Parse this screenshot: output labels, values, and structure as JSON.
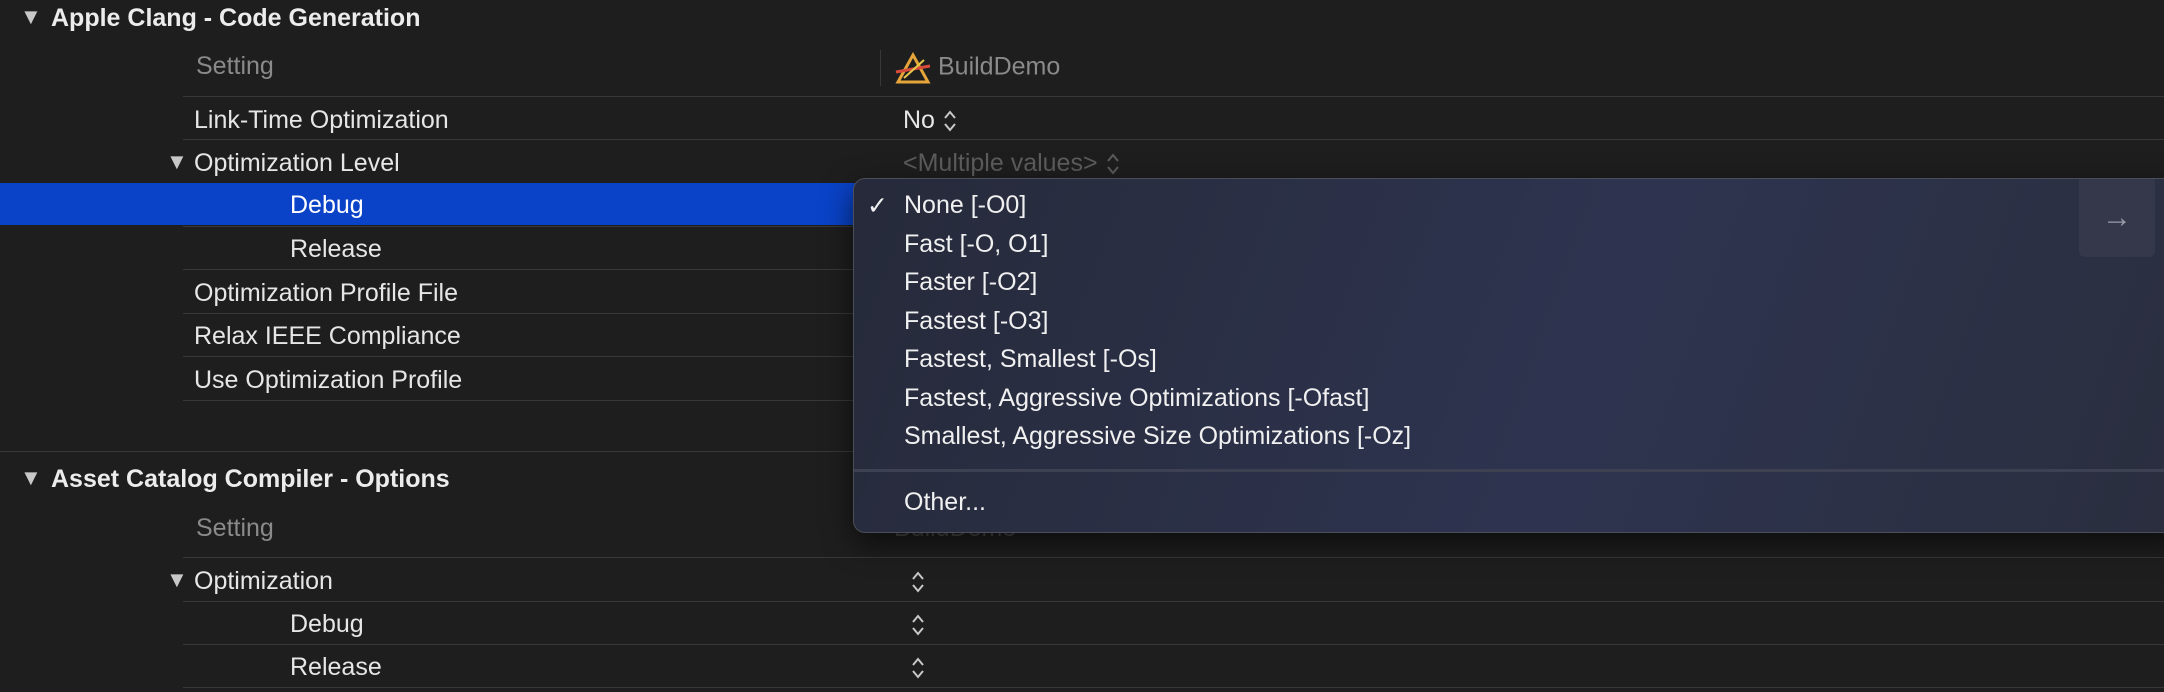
{
  "sections": [
    {
      "title": "Apple Clang - Code Generation",
      "header": {
        "setting": "Setting",
        "target": "BuildDemo"
      },
      "rows": [
        {
          "label": "Link-Time Optimization",
          "value": "No"
        },
        {
          "label": "Optimization Level",
          "value": "<Multiple values>"
        },
        {
          "label": "Debug",
          "value": ""
        },
        {
          "label": "Release",
          "value": ""
        },
        {
          "label": "Optimization Profile File",
          "value": ""
        },
        {
          "label": "Relax IEEE Compliance",
          "value": ""
        },
        {
          "label": "Use Optimization Profile",
          "value": ""
        }
      ]
    },
    {
      "title": "Asset Catalog Compiler - Options",
      "header": {
        "setting": "Setting",
        "target": "BuildDemo"
      },
      "rows": [
        {
          "label": "Optimization",
          "value": ""
        },
        {
          "label": "Debug",
          "value": ""
        },
        {
          "label": "Release",
          "value": ""
        }
      ]
    }
  ],
  "popup_menu": {
    "check_mark": "✓",
    "items": [
      {
        "label": "None [-O0]",
        "checked": true
      },
      {
        "label": "Fast [-O, O1]",
        "checked": false
      },
      {
        "label": "Faster [-O2]",
        "checked": false
      },
      {
        "label": "Fastest [-O3]",
        "checked": false
      },
      {
        "label": "Fastest, Smallest [-Os]",
        "checked": false
      },
      {
        "label": "Fastest, Aggressive Optimizations [-Ofast]",
        "checked": false
      },
      {
        "label": "Smallest, Aggressive Size Optimizations [-Oz]",
        "checked": false
      }
    ],
    "other_label": "Other...",
    "arrow_icon": "→"
  },
  "colors": {
    "background": "#1e1e1e",
    "selection": "#0a43c8",
    "menu": "#2c3148"
  }
}
